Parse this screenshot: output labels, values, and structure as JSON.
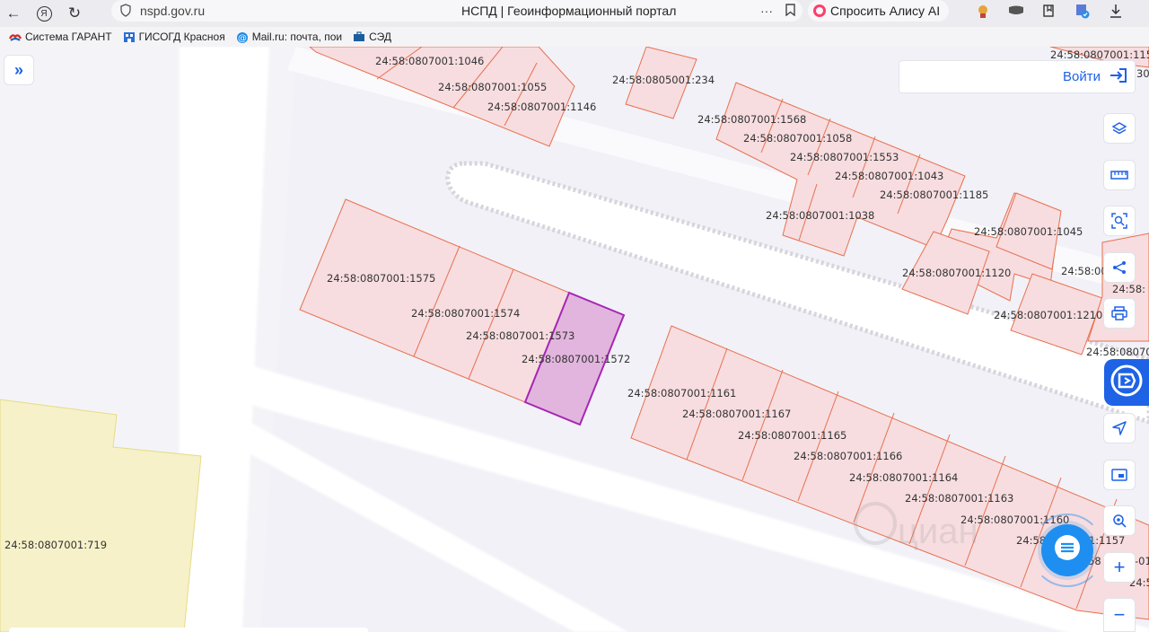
{
  "browser": {
    "url": "nspd.gov.ru",
    "title": "НСПД | Геоинформационный портал",
    "alice_label": "Спросить Алису AI"
  },
  "bookmarks": [
    {
      "label": "Система ГАРАНТ",
      "color": "#d32f2f"
    },
    {
      "label": "ГИСОГД Красноя",
      "color": "#2a6fd6"
    },
    {
      "label": "Mail.ru: почта, пои",
      "color": "#1e88e5"
    },
    {
      "label": "СЭД",
      "color": "#1b5e9e"
    }
  ],
  "login": {
    "label": "Войти"
  },
  "colors": {
    "accent": "#1e62e6",
    "parcel_fill": "#f7dde0",
    "parcel_stroke": "#e8704e",
    "selected_fill": "#e2b5de",
    "selected_stroke": "#a526b4",
    "zone_fill": "#f6f1c9"
  },
  "map": {
    "cadastral_labels": [
      "24:58:0807001:1046",
      "24:58:0807001:1055",
      "24:58:0807001:1146",
      "24:58:0805001:234",
      "24:58:0807001:1568",
      "24:58:0807001:1058",
      "24:58:0807001:1553",
      "24:58:0807001:1043",
      "24:58:0807001:1185",
      "24:58:0807001:1038",
      "24:58:0807001:1045",
      "24:58:0807001:1120",
      "24:58:0807001:1210",
      "24:58:0807001:1575",
      "24:58:0807001:1574",
      "24:58:0807001:1573",
      "24:58:0807001:1572",
      "24:58:0807001:1161",
      "24:58:0807001:1167",
      "24:58:0807001:1165",
      "24:58:0807001:1166",
      "24:58:0807001:1164",
      "24:58:0807001:1163",
      "24:58:0807001:1160",
      "24:58:0807001:719",
      "24:58:0807001:115",
      "24:58:0807001:1157",
      "24:58:00",
      "24:58:",
      "24:58:08070",
      "24:5",
      "307",
      "-01",
      "58"
    ],
    "selected_parcel": "24:58:0807001:1572"
  },
  "tools": [
    "layers-icon",
    "ruler-icon",
    "area-search-icon",
    "share-icon",
    "print-icon",
    "location-arrow-icon",
    "picture-in-picture-icon",
    "geo-search-icon",
    "zoom-in-icon",
    "zoom-out-icon"
  ],
  "zoom": {
    "in": "+",
    "out": "−"
  }
}
